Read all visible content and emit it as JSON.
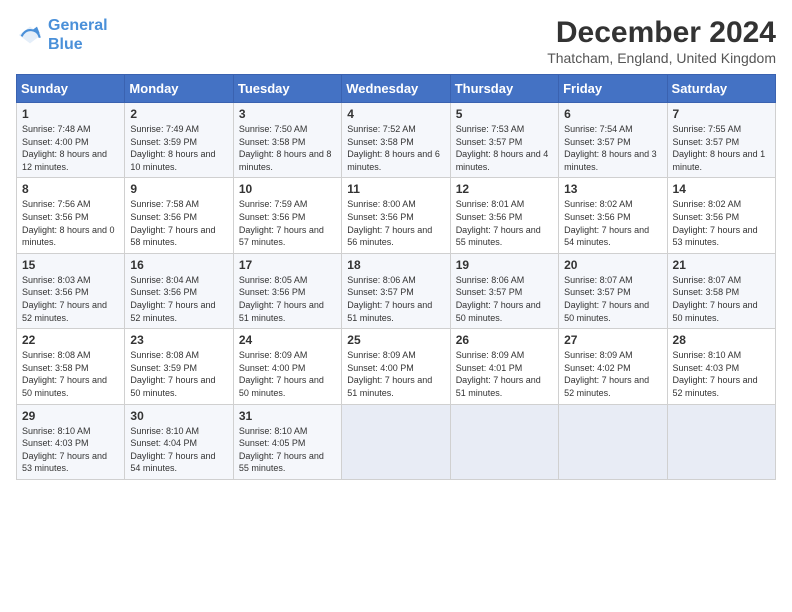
{
  "logo": {
    "line1": "General",
    "line2": "Blue"
  },
  "title": "December 2024",
  "location": "Thatcham, England, United Kingdom",
  "days_of_week": [
    "Sunday",
    "Monday",
    "Tuesday",
    "Wednesday",
    "Thursday",
    "Friday",
    "Saturday"
  ],
  "weeks": [
    [
      {
        "day": "1",
        "sunrise": "7:48 AM",
        "sunset": "4:00 PM",
        "daylight": "8 hours and 12 minutes."
      },
      {
        "day": "2",
        "sunrise": "7:49 AM",
        "sunset": "3:59 PM",
        "daylight": "8 hours and 10 minutes."
      },
      {
        "day": "3",
        "sunrise": "7:50 AM",
        "sunset": "3:58 PM",
        "daylight": "8 hours and 8 minutes."
      },
      {
        "day": "4",
        "sunrise": "7:52 AM",
        "sunset": "3:58 PM",
        "daylight": "8 hours and 6 minutes."
      },
      {
        "day": "5",
        "sunrise": "7:53 AM",
        "sunset": "3:57 PM",
        "daylight": "8 hours and 4 minutes."
      },
      {
        "day": "6",
        "sunrise": "7:54 AM",
        "sunset": "3:57 PM",
        "daylight": "8 hours and 3 minutes."
      },
      {
        "day": "7",
        "sunrise": "7:55 AM",
        "sunset": "3:57 PM",
        "daylight": "8 hours and 1 minute."
      }
    ],
    [
      {
        "day": "8",
        "sunrise": "7:56 AM",
        "sunset": "3:56 PM",
        "daylight": "8 hours and 0 minutes."
      },
      {
        "day": "9",
        "sunrise": "7:58 AM",
        "sunset": "3:56 PM",
        "daylight": "7 hours and 58 minutes."
      },
      {
        "day": "10",
        "sunrise": "7:59 AM",
        "sunset": "3:56 PM",
        "daylight": "7 hours and 57 minutes."
      },
      {
        "day": "11",
        "sunrise": "8:00 AM",
        "sunset": "3:56 PM",
        "daylight": "7 hours and 56 minutes."
      },
      {
        "day": "12",
        "sunrise": "8:01 AM",
        "sunset": "3:56 PM",
        "daylight": "7 hours and 55 minutes."
      },
      {
        "day": "13",
        "sunrise": "8:02 AM",
        "sunset": "3:56 PM",
        "daylight": "7 hours and 54 minutes."
      },
      {
        "day": "14",
        "sunrise": "8:02 AM",
        "sunset": "3:56 PM",
        "daylight": "7 hours and 53 minutes."
      }
    ],
    [
      {
        "day": "15",
        "sunrise": "8:03 AM",
        "sunset": "3:56 PM",
        "daylight": "7 hours and 52 minutes."
      },
      {
        "day": "16",
        "sunrise": "8:04 AM",
        "sunset": "3:56 PM",
        "daylight": "7 hours and 52 minutes."
      },
      {
        "day": "17",
        "sunrise": "8:05 AM",
        "sunset": "3:56 PM",
        "daylight": "7 hours and 51 minutes."
      },
      {
        "day": "18",
        "sunrise": "8:06 AM",
        "sunset": "3:57 PM",
        "daylight": "7 hours and 51 minutes."
      },
      {
        "day": "19",
        "sunrise": "8:06 AM",
        "sunset": "3:57 PM",
        "daylight": "7 hours and 50 minutes."
      },
      {
        "day": "20",
        "sunrise": "8:07 AM",
        "sunset": "3:57 PM",
        "daylight": "7 hours and 50 minutes."
      },
      {
        "day": "21",
        "sunrise": "8:07 AM",
        "sunset": "3:58 PM",
        "daylight": "7 hours and 50 minutes."
      }
    ],
    [
      {
        "day": "22",
        "sunrise": "8:08 AM",
        "sunset": "3:58 PM",
        "daylight": "7 hours and 50 minutes."
      },
      {
        "day": "23",
        "sunrise": "8:08 AM",
        "sunset": "3:59 PM",
        "daylight": "7 hours and 50 minutes."
      },
      {
        "day": "24",
        "sunrise": "8:09 AM",
        "sunset": "4:00 PM",
        "daylight": "7 hours and 50 minutes."
      },
      {
        "day": "25",
        "sunrise": "8:09 AM",
        "sunset": "4:00 PM",
        "daylight": "7 hours and 51 minutes."
      },
      {
        "day": "26",
        "sunrise": "8:09 AM",
        "sunset": "4:01 PM",
        "daylight": "7 hours and 51 minutes."
      },
      {
        "day": "27",
        "sunrise": "8:09 AM",
        "sunset": "4:02 PM",
        "daylight": "7 hours and 52 minutes."
      },
      {
        "day": "28",
        "sunrise": "8:10 AM",
        "sunset": "4:03 PM",
        "daylight": "7 hours and 52 minutes."
      }
    ],
    [
      {
        "day": "29",
        "sunrise": "8:10 AM",
        "sunset": "4:03 PM",
        "daylight": "7 hours and 53 minutes."
      },
      {
        "day": "30",
        "sunrise": "8:10 AM",
        "sunset": "4:04 PM",
        "daylight": "7 hours and 54 minutes."
      },
      {
        "day": "31",
        "sunrise": "8:10 AM",
        "sunset": "4:05 PM",
        "daylight": "7 hours and 55 minutes."
      },
      null,
      null,
      null,
      null
    ]
  ],
  "labels": {
    "sunrise": "Sunrise:",
    "sunset": "Sunset:",
    "daylight": "Daylight:"
  }
}
